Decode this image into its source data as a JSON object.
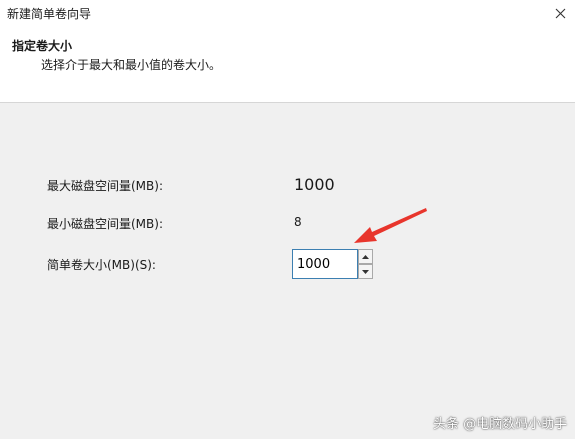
{
  "window": {
    "title": "新建简单卷向导"
  },
  "header": {
    "title": "指定卷大小",
    "description": "选择介于最大和最小值的卷大小。"
  },
  "fields": {
    "max_label": "最大磁盘空间量(MB):",
    "max_value": "1000",
    "min_label": "最小磁盘空间量(MB):",
    "min_value": "8",
    "size_label": "简单卷大小(MB)(S):",
    "size_value": "1000"
  },
  "watermark": {
    "text": "头条 @电脑数码小助手"
  },
  "colors": {
    "annotation_arrow": "#e8352c",
    "input_border": "#3c7fb1",
    "header_background": "#ffffff",
    "body_background": "#f0f0f0"
  },
  "icons": {
    "close": "close-icon",
    "spin_up": "chevron-up-icon",
    "spin_down": "chevron-down-icon",
    "annotation": "red-arrow-annotation"
  }
}
